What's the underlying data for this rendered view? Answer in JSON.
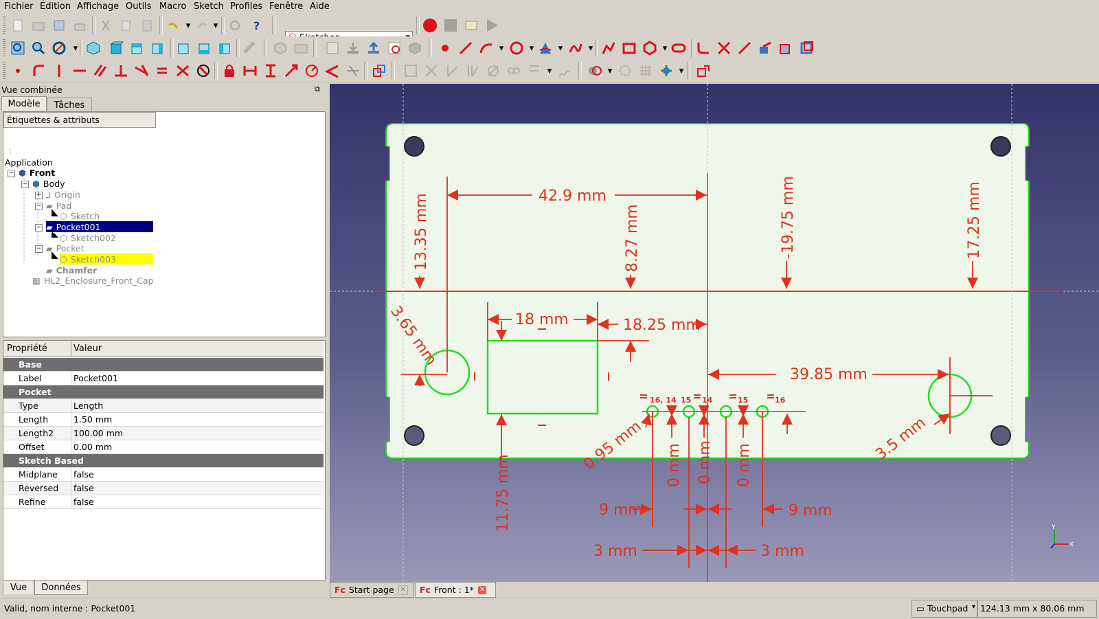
{
  "menu": [
    "Fichier",
    "Édition",
    "Affichage",
    "Outils",
    "Macro",
    "Sketch",
    "Profiles",
    "Fenêtre",
    "Aide"
  ],
  "toolbar": {
    "workbench": "Sketcher"
  },
  "combo": {
    "title": "Vue combinée",
    "tabs": [
      "Modèle",
      "Tâches"
    ],
    "tree_header": "Étiquettes & attributs",
    "tree": [
      {
        "label": "Application",
        "depth": 0
      },
      {
        "label": "Front",
        "depth": 1
      },
      {
        "label": "Body",
        "depth": 2
      },
      {
        "label": "Origin",
        "depth": 3
      },
      {
        "label": "Pad",
        "depth": 3
      },
      {
        "label": "Sketch",
        "depth": 4
      },
      {
        "label": "Pocket001",
        "depth": 3
      },
      {
        "label": "Sketch002",
        "depth": 4
      },
      {
        "label": "Pocket",
        "depth": 3
      },
      {
        "label": "Sketch003",
        "depth": 4
      },
      {
        "label": "Chamfer",
        "depth": 3
      },
      {
        "label": "HL2_Enclosure_Front_Cap",
        "depth": 2
      }
    ],
    "props_header": [
      "Propriété",
      "Valeur"
    ],
    "props": [
      {
        "group": "Base"
      },
      {
        "key": "Label",
        "value": "Pocket001"
      },
      {
        "group": "Pocket"
      },
      {
        "key": "Type",
        "value": "Length"
      },
      {
        "key": "Length",
        "value": "1.50 mm"
      },
      {
        "key": "Length2",
        "value": "100.00 mm"
      },
      {
        "key": "Offset",
        "value": "0.00 mm"
      },
      {
        "group": "Sketch Based"
      },
      {
        "key": "Midplane",
        "value": "false"
      },
      {
        "key": "Reversed",
        "value": "false"
      },
      {
        "key": "Refine",
        "value": "false"
      }
    ],
    "bottom_tabs": [
      "Vue",
      "Données"
    ]
  },
  "sketch": {
    "dims": {
      "d1": "42.9 mm",
      "d2": "13.35 mm",
      "d3": "8.27 mm",
      "d4": "-19.75 mm",
      "d5": "17.25 mm",
      "d6": "3.65 mm",
      "d7": "18 mm",
      "d8": "18.25 mm",
      "d9": "39.85 mm",
      "d10": "0.95 mm",
      "d11": "0 mm",
      "d12": "0 mm",
      "d13": "0 mm",
      "d14": "11.75 mm",
      "d15": "9 mm",
      "d16": "9 mm",
      "d17": "3 mm",
      "d18": "3 mm",
      "d19": "3.5 mm"
    },
    "labels": {
      "l1": "16, 14",
      "l2": "15",
      "l3": "14",
      "l4": "15",
      "l5": "16"
    },
    "axis_y": "Y",
    "axis_x": "X"
  },
  "doc_tabs": [
    {
      "label": "Start page"
    },
    {
      "label": "Front : 1*"
    }
  ],
  "status": {
    "message": "Valid, nom interne : Pocket001",
    "nav": "Touchpad",
    "dims": "124.13 mm x 80.06 mm"
  },
  "colors": {
    "dimension": "#e0321e",
    "geometry": "#22dd22",
    "selected_tree": "#000080",
    "highlight_tree": "#ffff00"
  }
}
